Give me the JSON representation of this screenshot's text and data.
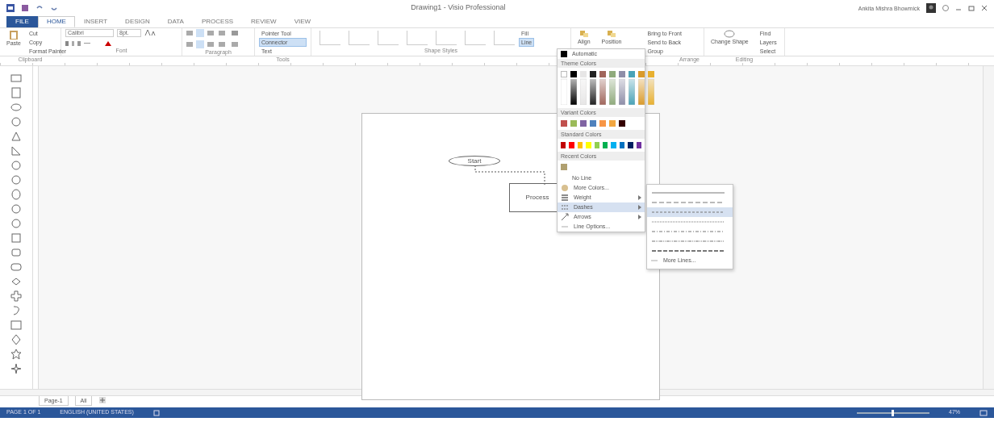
{
  "window": {
    "title": "Drawing1 - Visio Professional",
    "user": "Ankita Mishra Bhowmick"
  },
  "tabs": [
    {
      "label": "FILE",
      "selected": false,
      "kind": "file"
    },
    {
      "label": "HOME",
      "selected": true,
      "kind": "tab"
    },
    {
      "label": "INSERT",
      "selected": false,
      "kind": "tab"
    },
    {
      "label": "DESIGN",
      "selected": false,
      "kind": "tab"
    },
    {
      "label": "DATA",
      "selected": false,
      "kind": "tab"
    },
    {
      "label": "PROCESS",
      "selected": false,
      "kind": "tab"
    },
    {
      "label": "REVIEW",
      "selected": false,
      "kind": "tab"
    },
    {
      "label": "VIEW",
      "selected": false,
      "kind": "tab"
    }
  ],
  "ribbon": {
    "clipboard": {
      "paste": "Paste",
      "items": [
        "Cut",
        "Copy",
        "Format Painter"
      ],
      "label": "Clipboard"
    },
    "font": {
      "name": "Calibri",
      "size": "8pt.",
      "label": "Font"
    },
    "paragraph": {
      "label": "Paragraph"
    },
    "tools": {
      "items": [
        {
          "label": "Pointer Tool",
          "selected": false
        },
        {
          "label": "Connector",
          "selected": true
        },
        {
          "label": "Text",
          "selected": false
        }
      ],
      "label": "Tools"
    },
    "shape_styles": {
      "label": "Shape Styles",
      "buttons": [
        {
          "label": "Fill",
          "open": false
        },
        {
          "label": "Line",
          "open": true
        }
      ]
    },
    "arrange": {
      "big": [
        "Align",
        "Position"
      ],
      "items": [
        "Bring to Front",
        "Send to Back",
        "Group"
      ],
      "label": "Arrange"
    },
    "editing": {
      "change_shape": "Change Shape",
      "items": [
        "Find",
        "Layers",
        "Select"
      ],
      "label": "Editing"
    }
  },
  "diagram": {
    "ellipse": "Start",
    "rect": "Process"
  },
  "line_menu": {
    "automatic": "Automatic",
    "theme_header": "Theme Colors",
    "theme_colors": [
      {
        "color": "#ffffff"
      },
      {
        "color": "#000000"
      },
      {
        "color": "#e7e6e6"
      },
      {
        "color": "#222222"
      },
      {
        "color": "#a0665c"
      },
      {
        "color": "#8faa7c"
      },
      {
        "color": "#8e8ea8"
      },
      {
        "color": "#4aa3b7"
      },
      {
        "color": "#d99a2b"
      },
      {
        "color": "#e8b030"
      }
    ],
    "variant_header": "Variant Colors",
    "variant_colors": [
      {
        "color": "#c0504d"
      },
      {
        "color": "#9bbb59"
      },
      {
        "color": "#8064a2"
      },
      {
        "color": "#4f81bd"
      },
      {
        "color": "#f79646"
      },
      {
        "color": "#f2a640"
      },
      {
        "color": "#330000"
      }
    ],
    "standard_header": "Standard Colors",
    "standard_colors": [
      {
        "color": "#c00000"
      },
      {
        "color": "#ff0000"
      },
      {
        "color": "#ffc000"
      },
      {
        "color": "#ffff00"
      },
      {
        "color": "#92d050"
      },
      {
        "color": "#00b050"
      },
      {
        "color": "#00b0f0"
      },
      {
        "color": "#0070c0"
      },
      {
        "color": "#002060"
      },
      {
        "color": "#7030a0"
      }
    ],
    "recent_header": "Recent Colors",
    "recent_colors": [
      {
        "color": "#b0a070"
      }
    ],
    "items": [
      {
        "label": "No Line",
        "kind": "plain",
        "submenu": false,
        "selected": false
      },
      {
        "label": "More Colors...",
        "kind": "palette",
        "submenu": false,
        "selected": false
      },
      {
        "label": "Weight",
        "kind": "weight",
        "submenu": true,
        "selected": false
      },
      {
        "label": "Dashes",
        "kind": "dashes",
        "submenu": true,
        "selected": true
      },
      {
        "label": "Arrows",
        "kind": "arrows",
        "submenu": true,
        "selected": false
      },
      {
        "label": "Line Options...",
        "kind": "options",
        "submenu": false,
        "selected": false
      }
    ]
  },
  "dashes_menu": {
    "styles": [
      {
        "kind": "solid",
        "selected": false
      },
      {
        "kind": "longdash",
        "selected": false
      },
      {
        "kind": "dash",
        "selected": true
      },
      {
        "kind": "dot",
        "selected": false
      },
      {
        "kind": "dashdot",
        "selected": false
      },
      {
        "kind": "dashdotdot",
        "selected": false
      },
      {
        "kind": "heavy",
        "selected": false
      }
    ],
    "more": "More Lines..."
  },
  "page_tabs": {
    "page": "Page-1",
    "all": "All"
  },
  "status_bar": {
    "page": "PAGE 1 OF 1",
    "language": "ENGLISH (UNITED STATES)",
    "level": 0.5,
    "zoom": "47%"
  }
}
